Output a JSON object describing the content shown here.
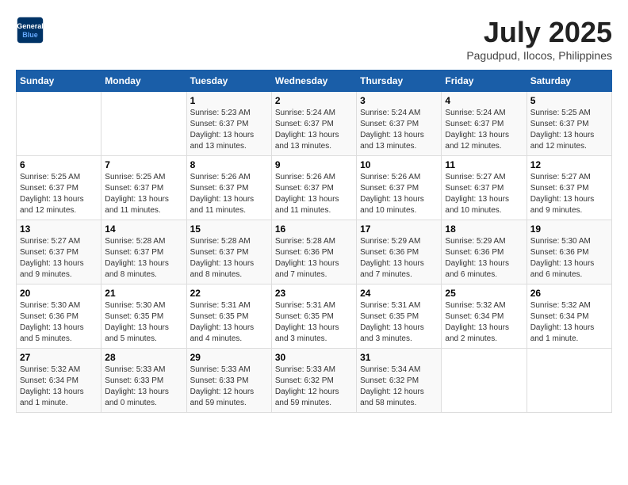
{
  "header": {
    "logo_line1": "General",
    "logo_line2": "Blue",
    "month": "July 2025",
    "location": "Pagudpud, Ilocos, Philippines"
  },
  "days_of_week": [
    "Sunday",
    "Monday",
    "Tuesday",
    "Wednesday",
    "Thursday",
    "Friday",
    "Saturday"
  ],
  "weeks": [
    [
      {
        "day": "",
        "detail": ""
      },
      {
        "day": "",
        "detail": ""
      },
      {
        "day": "1",
        "detail": "Sunrise: 5:23 AM\nSunset: 6:37 PM\nDaylight: 13 hours\nand 13 minutes."
      },
      {
        "day": "2",
        "detail": "Sunrise: 5:24 AM\nSunset: 6:37 PM\nDaylight: 13 hours\nand 13 minutes."
      },
      {
        "day": "3",
        "detail": "Sunrise: 5:24 AM\nSunset: 6:37 PM\nDaylight: 13 hours\nand 13 minutes."
      },
      {
        "day": "4",
        "detail": "Sunrise: 5:24 AM\nSunset: 6:37 PM\nDaylight: 13 hours\nand 12 minutes."
      },
      {
        "day": "5",
        "detail": "Sunrise: 5:25 AM\nSunset: 6:37 PM\nDaylight: 13 hours\nand 12 minutes."
      }
    ],
    [
      {
        "day": "6",
        "detail": "Sunrise: 5:25 AM\nSunset: 6:37 PM\nDaylight: 13 hours\nand 12 minutes."
      },
      {
        "day": "7",
        "detail": "Sunrise: 5:25 AM\nSunset: 6:37 PM\nDaylight: 13 hours\nand 11 minutes."
      },
      {
        "day": "8",
        "detail": "Sunrise: 5:26 AM\nSunset: 6:37 PM\nDaylight: 13 hours\nand 11 minutes."
      },
      {
        "day": "9",
        "detail": "Sunrise: 5:26 AM\nSunset: 6:37 PM\nDaylight: 13 hours\nand 11 minutes."
      },
      {
        "day": "10",
        "detail": "Sunrise: 5:26 AM\nSunset: 6:37 PM\nDaylight: 13 hours\nand 10 minutes."
      },
      {
        "day": "11",
        "detail": "Sunrise: 5:27 AM\nSunset: 6:37 PM\nDaylight: 13 hours\nand 10 minutes."
      },
      {
        "day": "12",
        "detail": "Sunrise: 5:27 AM\nSunset: 6:37 PM\nDaylight: 13 hours\nand 9 minutes."
      }
    ],
    [
      {
        "day": "13",
        "detail": "Sunrise: 5:27 AM\nSunset: 6:37 PM\nDaylight: 13 hours\nand 9 minutes."
      },
      {
        "day": "14",
        "detail": "Sunrise: 5:28 AM\nSunset: 6:37 PM\nDaylight: 13 hours\nand 8 minutes."
      },
      {
        "day": "15",
        "detail": "Sunrise: 5:28 AM\nSunset: 6:37 PM\nDaylight: 13 hours\nand 8 minutes."
      },
      {
        "day": "16",
        "detail": "Sunrise: 5:28 AM\nSunset: 6:36 PM\nDaylight: 13 hours\nand 7 minutes."
      },
      {
        "day": "17",
        "detail": "Sunrise: 5:29 AM\nSunset: 6:36 PM\nDaylight: 13 hours\nand 7 minutes."
      },
      {
        "day": "18",
        "detail": "Sunrise: 5:29 AM\nSunset: 6:36 PM\nDaylight: 13 hours\nand 6 minutes."
      },
      {
        "day": "19",
        "detail": "Sunrise: 5:30 AM\nSunset: 6:36 PM\nDaylight: 13 hours\nand 6 minutes."
      }
    ],
    [
      {
        "day": "20",
        "detail": "Sunrise: 5:30 AM\nSunset: 6:36 PM\nDaylight: 13 hours\nand 5 minutes."
      },
      {
        "day": "21",
        "detail": "Sunrise: 5:30 AM\nSunset: 6:35 PM\nDaylight: 13 hours\nand 5 minutes."
      },
      {
        "day": "22",
        "detail": "Sunrise: 5:31 AM\nSunset: 6:35 PM\nDaylight: 13 hours\nand 4 minutes."
      },
      {
        "day": "23",
        "detail": "Sunrise: 5:31 AM\nSunset: 6:35 PM\nDaylight: 13 hours\nand 3 minutes."
      },
      {
        "day": "24",
        "detail": "Sunrise: 5:31 AM\nSunset: 6:35 PM\nDaylight: 13 hours\nand 3 minutes."
      },
      {
        "day": "25",
        "detail": "Sunrise: 5:32 AM\nSunset: 6:34 PM\nDaylight: 13 hours\nand 2 minutes."
      },
      {
        "day": "26",
        "detail": "Sunrise: 5:32 AM\nSunset: 6:34 PM\nDaylight: 13 hours\nand 1 minute."
      }
    ],
    [
      {
        "day": "27",
        "detail": "Sunrise: 5:32 AM\nSunset: 6:34 PM\nDaylight: 13 hours\nand 1 minute."
      },
      {
        "day": "28",
        "detail": "Sunrise: 5:33 AM\nSunset: 6:33 PM\nDaylight: 13 hours\nand 0 minutes."
      },
      {
        "day": "29",
        "detail": "Sunrise: 5:33 AM\nSunset: 6:33 PM\nDaylight: 12 hours\nand 59 minutes."
      },
      {
        "day": "30",
        "detail": "Sunrise: 5:33 AM\nSunset: 6:32 PM\nDaylight: 12 hours\nand 59 minutes."
      },
      {
        "day": "31",
        "detail": "Sunrise: 5:34 AM\nSunset: 6:32 PM\nDaylight: 12 hours\nand 58 minutes."
      },
      {
        "day": "",
        "detail": ""
      },
      {
        "day": "",
        "detail": ""
      }
    ]
  ]
}
